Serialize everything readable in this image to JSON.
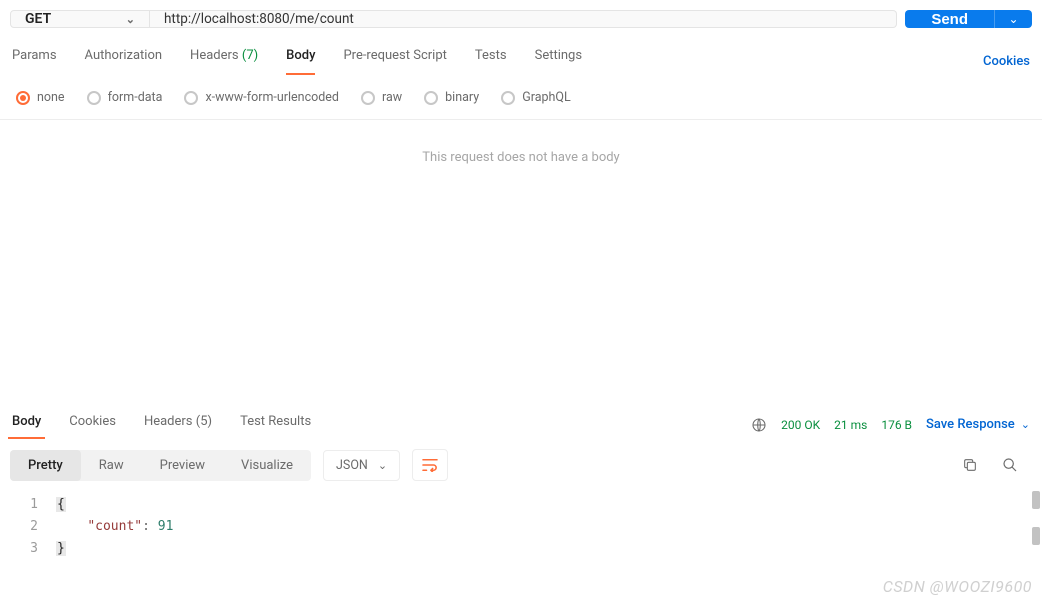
{
  "request": {
    "method": "GET",
    "url": "http://localhost:8080/me/count",
    "send_label": "Send"
  },
  "request_tabs": {
    "params": "Params",
    "authorization": "Authorization",
    "headers_label": "Headers",
    "headers_count": "(7)",
    "body": "Body",
    "prerequest": "Pre-request Script",
    "tests": "Tests",
    "settings": "Settings",
    "cookies": "Cookies"
  },
  "body_types": {
    "none": "none",
    "formdata": "form-data",
    "urlencoded": "x-www-form-urlencoded",
    "raw": "raw",
    "binary": "binary",
    "graphql": "GraphQL"
  },
  "no_body_msg": "This request does not have a body",
  "response_tabs": {
    "body": "Body",
    "cookies": "Cookies",
    "headers_label": "Headers",
    "headers_count": "(5)",
    "test_results": "Test Results"
  },
  "response_meta": {
    "status": "200 OK",
    "time": "21 ms",
    "size": "176 B",
    "save_response": "Save Response"
  },
  "view_tabs": {
    "pretty": "Pretty",
    "raw": "Raw",
    "preview": "Preview",
    "visualize": "Visualize",
    "format": "JSON"
  },
  "code": {
    "l1_num": "1",
    "l1_brace": "{",
    "l2_num": "2",
    "l2_indent": "    ",
    "l2_key": "\"count\"",
    "l2_colon": ": ",
    "l2_val": "91",
    "l3_num": "3",
    "l3_brace": "}"
  },
  "watermark": "CSDN @WOOZI9600"
}
